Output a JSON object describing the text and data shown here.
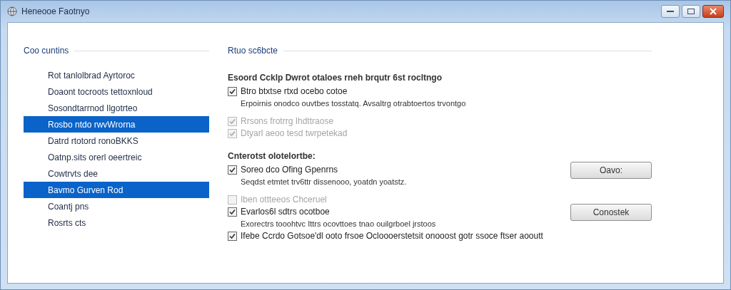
{
  "window": {
    "title": "Heneooe Faotnyo"
  },
  "left_group": {
    "title": "Coo cuntins",
    "items": [
      {
        "label": "Rot tanlolbrad Ayrtoroc",
        "selected": false
      },
      {
        "label": "Doaont tocroots tettoxnloud",
        "selected": false
      },
      {
        "label": "Sosondtarrnod Ilgotrteo",
        "selected": false
      },
      {
        "label": "Rosbo ntdo rwvWrorna",
        "selected": true
      },
      {
        "label": "Datrd rtotord ronoBKKS",
        "selected": false
      },
      {
        "label": "Oatnp.sits orerl oeertreic",
        "selected": false
      },
      {
        "label": "Cowtrvts dee",
        "selected": false
      },
      {
        "label": "Bavmo Gurven Rod",
        "selected": true
      },
      {
        "label": "Coantj pns",
        "selected": false
      },
      {
        "label": "Rosrts cts",
        "selected": false
      }
    ]
  },
  "right_group": {
    "title": "Rtuo sc6bcte",
    "sections": [
      {
        "heading": "Esoord Ccklp Dwrot otaloes rneh brqutr 6st rocltngo",
        "options": [
          {
            "label": "Btro btxtse rtxd ocebo cotoe",
            "checked": true,
            "disabled": false,
            "description": "Erpoirnis onodco ouvtbes tosstatq. Avsaltrg otrabtoertos trvontgo"
          }
        ]
      },
      {
        "options": [
          {
            "label": "Rrsons frotrrg Ihdttraose",
            "checked": true,
            "disabled": true
          },
          {
            "label": "Dtyarl aeoo tesd twrpetekad",
            "checked": true,
            "disabled": true
          }
        ]
      },
      {
        "heading": "Cnterotst olotelortbe:",
        "options": [
          {
            "label": "Soreo dco Ofing Gpenrns",
            "checked": true,
            "disabled": false,
            "description": "Seqdst etmtet trv6ttr dissenooo, yoatdn yoatstz.",
            "button": "Oavo:"
          }
        ]
      },
      {
        "options": [
          {
            "label": "Iben ottteeos Chceruel",
            "checked": false,
            "disabled": true
          },
          {
            "label": "Evarlos6l sdtrs ocotboe",
            "checked": true,
            "disabled": false,
            "description": "Exorectrs tooohtvc Ittrs ocovttoes tnao ouilgrboel jrstoos",
            "button": "Conostek"
          },
          {
            "label": "Ifebe Ccrdo Gotsoe'dl ooto frsoe Ocloooerstetsit onooost gotr ssoce ftser aooutt",
            "checked": true,
            "disabled": false
          }
        ]
      }
    ]
  }
}
